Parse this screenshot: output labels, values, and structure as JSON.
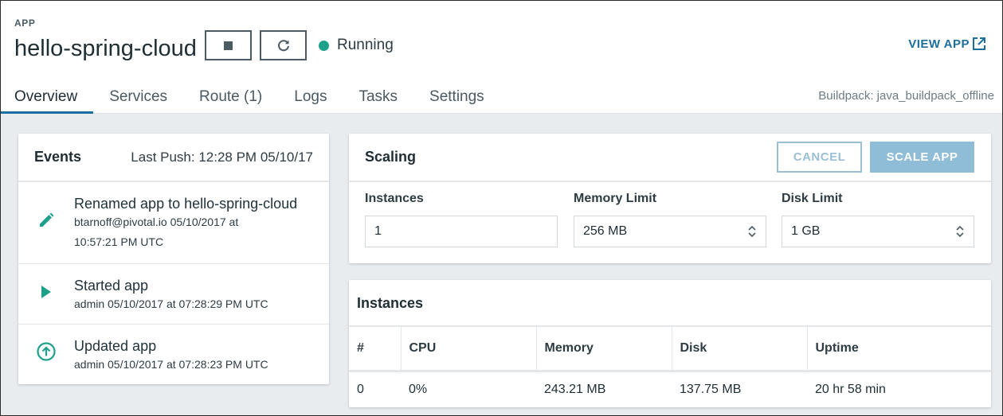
{
  "app": {
    "label": "APP",
    "name": "hello-spring-cloud",
    "status": "Running",
    "view_app_label": "VIEW APP",
    "buildpack": "Buildpack: java_buildpack_offline"
  },
  "tabs": [
    {
      "label": "Overview",
      "active": true
    },
    {
      "label": "Services"
    },
    {
      "label": "Route (1)"
    },
    {
      "label": "Logs"
    },
    {
      "label": "Tasks"
    },
    {
      "label": "Settings"
    }
  ],
  "events": {
    "title": "Events",
    "last_push": "Last Push: 12:28 PM 05/10/17",
    "items": [
      {
        "icon": "pencil-icon",
        "title": "Renamed app to hello-spring-cloud",
        "meta_line1": "btarnoff@pivotal.io 05/10/2017 at",
        "meta_line2": "10:57:21 PM UTC"
      },
      {
        "icon": "play-icon",
        "title": "Started app",
        "meta_line1": "admin 05/10/2017 at 07:28:29 PM UTC"
      },
      {
        "icon": "upload-icon",
        "title": "Updated app",
        "meta_line1": "admin 05/10/2017 at 07:28:23 PM UTC"
      }
    ]
  },
  "scaling": {
    "title": "Scaling",
    "cancel_label": "CANCEL",
    "scale_label": "SCALE APP",
    "instances_label": "Instances",
    "instances_value": "1",
    "memory_label": "Memory Limit",
    "memory_value": "256 MB",
    "disk_label": "Disk Limit",
    "disk_value": "1 GB"
  },
  "instances": {
    "title": "Instances",
    "columns": [
      "#",
      "CPU",
      "Memory",
      "Disk",
      "Uptime"
    ],
    "rows": [
      [
        "0",
        "0%",
        "243.21 MB",
        "137.75 MB",
        "20 hr 58 min"
      ]
    ]
  },
  "colors": {
    "accent": "#1c6f9c",
    "running": "#1ea08b",
    "icon_teal": "#1ea08b"
  }
}
